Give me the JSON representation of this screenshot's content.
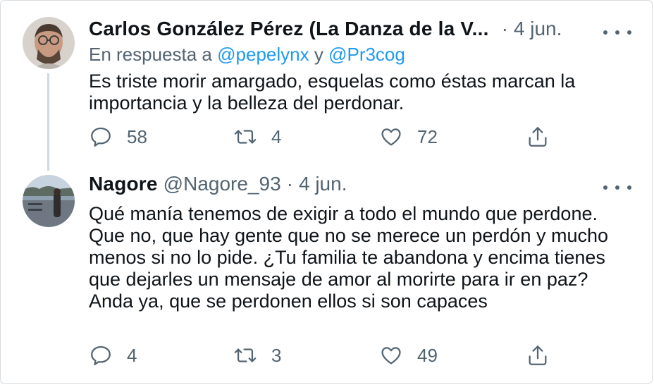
{
  "tweets": [
    {
      "author": "Carlos González Pérez (La Danza de la V...",
      "dot": "·",
      "date": "4 jun.",
      "reply_prefix": "En respuesta a",
      "reply_mention_1": "@pepelynx",
      "reply_joiner": "y",
      "reply_mention_2": "@Pr3cog",
      "text": "Es triste morir amargado, esquelas como éstas marcan la importancia y la belleza del perdonar.",
      "replies": "58",
      "retweets": "4",
      "likes": "72"
    },
    {
      "author": "Nagore",
      "handle": "@Nagore_93",
      "dot": "·",
      "date": "4 jun.",
      "text": "Qué manía tenemos de exigir a todo el mundo que perdone. Que no, que hay gente que no se merece un perdón y mucho menos si no lo pide. ¿Tu familia te abandona y encima tienes que dejarles un mensaje de amor al morirte para ir en paz? Anda ya, que se perdonen ellos si son capaces",
      "replies": "4",
      "retweets": "3",
      "likes": "49"
    }
  ],
  "icons": {
    "reply": "reply-icon",
    "retweet": "retweet-icon",
    "like": "heart-icon",
    "share": "share-icon",
    "more": "more-icon"
  },
  "colors": {
    "text": "#0f1419",
    "secondary": "#536471",
    "link": "#1d9bf0",
    "thread_line": "#cfd9de"
  }
}
